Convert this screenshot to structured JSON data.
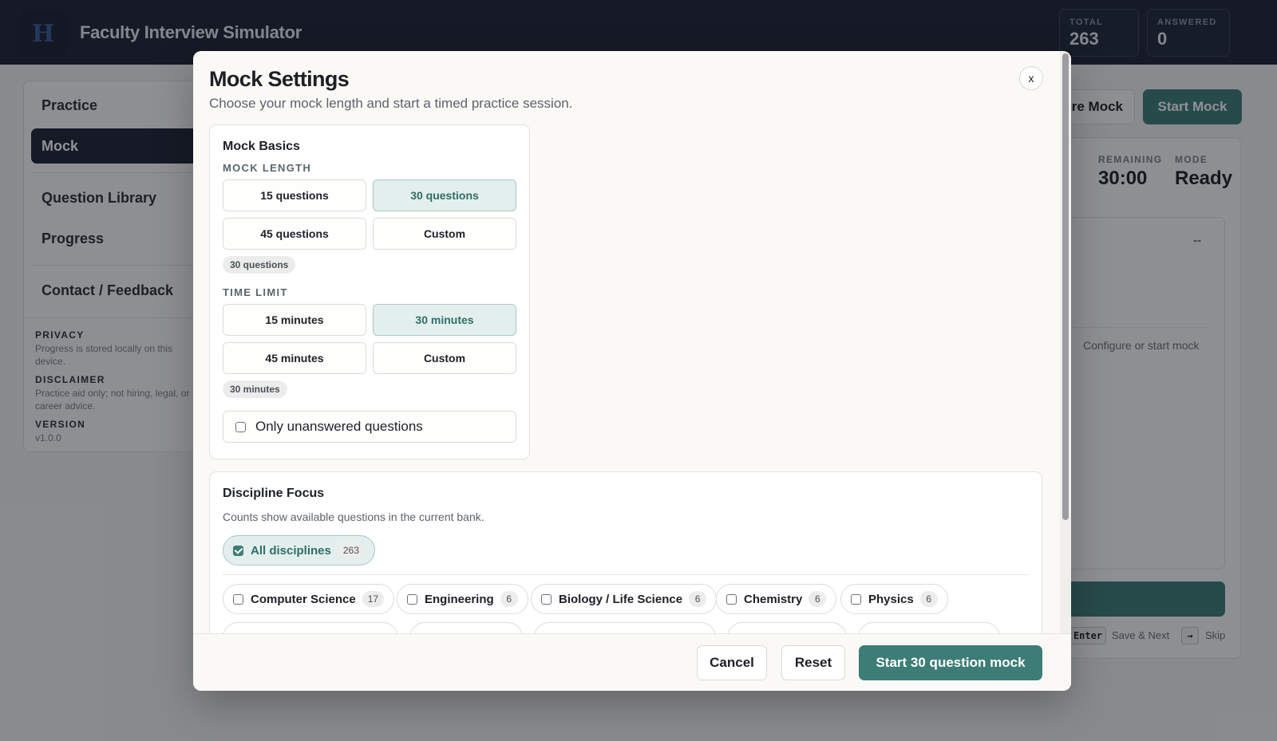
{
  "app": {
    "logo_text": "H",
    "title": "Faculty Interview Simulator",
    "stats": [
      {
        "label": "TOTAL",
        "value": "263"
      },
      {
        "label": "ANSWERED",
        "value": "0"
      }
    ]
  },
  "sidebar": {
    "items": [
      {
        "label": "Practice"
      },
      {
        "label": "Mock"
      },
      {
        "label": "Question Library"
      },
      {
        "label": "Progress"
      },
      {
        "label": "Contact / Feedback"
      }
    ],
    "active": "Mock",
    "meta": [
      {
        "heading": "PRIVACY",
        "text": "Progress is stored locally on this device."
      },
      {
        "heading": "DISCLAIMER",
        "text": "Practice aid only; not hiring, legal, or career advice."
      },
      {
        "heading": "VERSION",
        "text": "v1.0.0"
      }
    ]
  },
  "page": {
    "configure_btn_partial": "re Mock",
    "start_btn": "Start Mock",
    "remaining_label": "REMAINING",
    "remaining_value": "30:00",
    "mode_label": "MODE",
    "mode_value": "Ready",
    "question_counter": "--",
    "placeholder": "Configure or start mock",
    "hint_key_enter": "Enter",
    "hint_save": "Save & Next",
    "hint_key_skip": "→",
    "hint_skip": "Skip"
  },
  "modal": {
    "title": "Mock Settings",
    "subtitle": "Choose your mock length and start a timed practice session.",
    "close_label": "x",
    "basics": {
      "heading": "Mock Basics",
      "length_label": "MOCK LENGTH",
      "length_options": [
        "15 questions",
        "30 questions",
        "45 questions",
        "Custom"
      ],
      "length_selected": "30 questions",
      "length_summary": "30 questions",
      "time_label": "TIME LIMIT",
      "time_options": [
        "15 minutes",
        "30 minutes",
        "45 minutes",
        "Custom"
      ],
      "time_selected": "30 minutes",
      "time_summary": "30 minutes",
      "unanswered_label": "Only unanswered questions",
      "unanswered_checked": false
    },
    "discipline": {
      "heading": "Discipline Focus",
      "subtitle": "Counts show available questions in the current bank.",
      "all": {
        "label": "All disciplines",
        "count": "263",
        "checked": true
      },
      "items": [
        {
          "label": "Computer Science",
          "count": "17",
          "checked": false
        },
        {
          "label": "Engineering",
          "count": "6",
          "checked": false
        },
        {
          "label": "Biology / Life Science",
          "count": "6",
          "checked": false
        },
        {
          "label": "Chemistry",
          "count": "6",
          "checked": false
        },
        {
          "label": "Physics",
          "count": "6",
          "checked": false
        }
      ]
    },
    "footer": {
      "cancel": "Cancel",
      "reset": "Reset",
      "start": "Start 30 question mock"
    }
  },
  "colors": {
    "accent": "#3d7d76",
    "accent_soft": "#e3efed",
    "header_bg": "#1d2433"
  }
}
